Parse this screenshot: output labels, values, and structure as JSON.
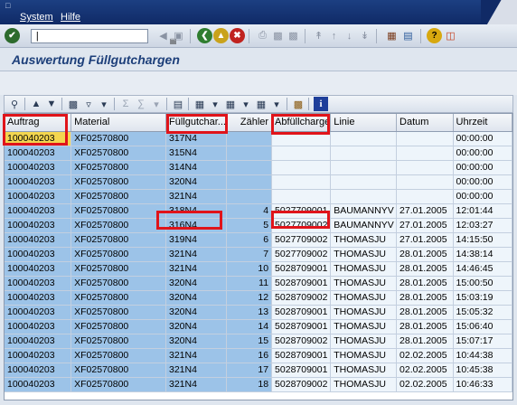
{
  "menubar": {
    "items": [
      "System",
      "Hilfe"
    ]
  },
  "toolbar": {
    "command_value": ""
  },
  "title": "Auswertung Füllgutchargen",
  "grid": {
    "columns": [
      "Auftrag",
      "Material",
      "Füllgutchar...",
      "Zähler",
      "Abfüllcharge",
      "Linie",
      "Datum",
      "Uhrzeit"
    ],
    "rows": [
      [
        "100040203",
        "XF02570800",
        "317N4",
        "",
        "",
        "",
        "",
        "00:00:00"
      ],
      [
        "100040203",
        "XF02570800",
        "315N4",
        "",
        "",
        "",
        "",
        "00:00:00"
      ],
      [
        "100040203",
        "XF02570800",
        "314N4",
        "",
        "",
        "",
        "",
        "00:00:00"
      ],
      [
        "100040203",
        "XF02570800",
        "320N4",
        "",
        "",
        "",
        "",
        "00:00:00"
      ],
      [
        "100040203",
        "XF02570800",
        "321N4",
        "",
        "",
        "",
        "",
        "00:00:00"
      ],
      [
        "100040203",
        "XF02570800",
        "318N4",
        "4",
        "5027709001",
        "BAUMANNYV",
        "27.01.2005",
        "12:01:44"
      ],
      [
        "100040203",
        "XF02570800",
        "316N4",
        "5",
        "5027709002",
        "BAUMANNYV",
        "27.01.2005",
        "12:03:27"
      ],
      [
        "100040203",
        "XF02570800",
        "319N4",
        "6",
        "5027709002",
        "THOMASJU",
        "27.01.2005",
        "14:15:50"
      ],
      [
        "100040203",
        "XF02570800",
        "321N4",
        "7",
        "5027709002",
        "THOMASJU",
        "28.01.2005",
        "14:38:14"
      ],
      [
        "100040203",
        "XF02570800",
        "321N4",
        "10",
        "5028709001",
        "THOMASJU",
        "28.01.2005",
        "14:46:45"
      ],
      [
        "100040203",
        "XF02570800",
        "320N4",
        "11",
        "5028709001",
        "THOMASJU",
        "28.01.2005",
        "15:00:50"
      ],
      [
        "100040203",
        "XF02570800",
        "320N4",
        "12",
        "5028709002",
        "THOMASJU",
        "28.01.2005",
        "15:03:19"
      ],
      [
        "100040203",
        "XF02570800",
        "320N4",
        "13",
        "5028709001",
        "THOMASJU",
        "28.01.2005",
        "15:05:32"
      ],
      [
        "100040203",
        "XF02570800",
        "320N4",
        "14",
        "5028709001",
        "THOMASJU",
        "28.01.2005",
        "15:06:40"
      ],
      [
        "100040203",
        "XF02570800",
        "320N4",
        "15",
        "5028709002",
        "THOMASJU",
        "28.01.2005",
        "15:07:17"
      ],
      [
        "100040203",
        "XF02570800",
        "321N4",
        "16",
        "5028709001",
        "THOMASJU",
        "02.02.2005",
        "10:44:38"
      ],
      [
        "100040203",
        "XF02570800",
        "321N4",
        "17",
        "5028709001",
        "THOMASJU",
        "02.02.2005",
        "10:45:38"
      ],
      [
        "100040203",
        "XF02570800",
        "321N4",
        "18",
        "5028709002",
        "THOMASJU",
        "02.02.2005",
        "10:46:33"
      ]
    ]
  },
  "colors": {
    "menubar": "#1c3f82",
    "selected_cell": "#9cc3e8",
    "highlight": "#e0141a",
    "current_cell": "#f3d64f"
  }
}
